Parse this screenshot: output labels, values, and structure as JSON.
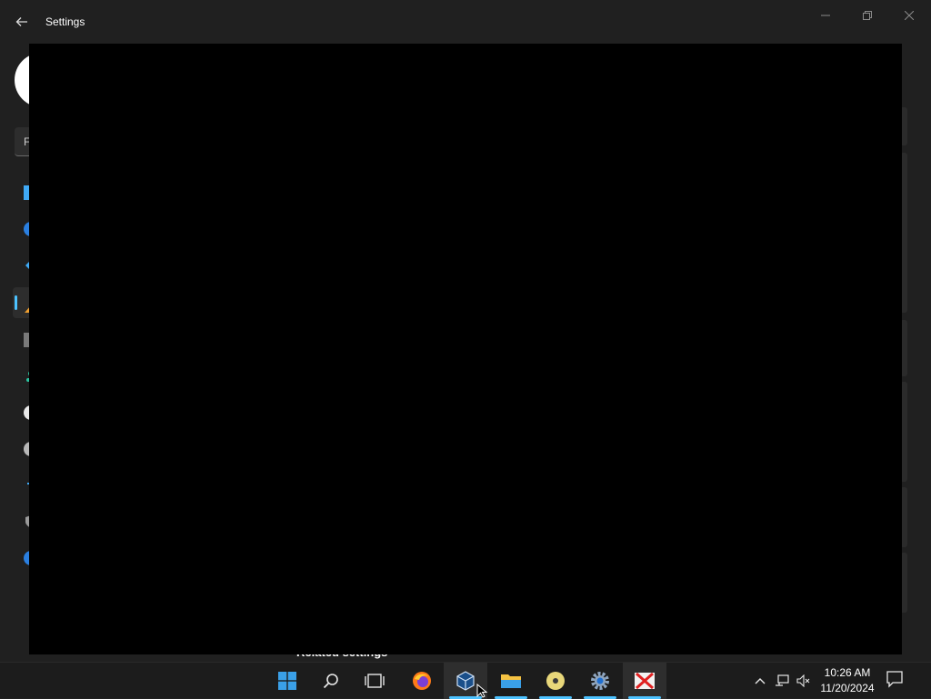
{
  "window": {
    "title": "Settings",
    "back_icon": "arrow-left-icon",
    "minimize_icon": "minimize-icon",
    "maximize_icon": "restore-icon",
    "close_icon": "close-icon"
  },
  "settings_fragments": {
    "search_partial_text": "F",
    "related_settings": "Related settings"
  },
  "taskbar": {
    "apps": [
      {
        "name": "start",
        "icon": "windows-start-icon"
      },
      {
        "name": "search",
        "icon": "search-icon"
      },
      {
        "name": "task-view",
        "icon": "task-view-icon"
      },
      {
        "name": "firefox",
        "icon": "firefox-icon"
      },
      {
        "name": "virtualbox",
        "icon": "virtualbox-icon"
      },
      {
        "name": "file-explorer",
        "icon": "folder-icon"
      },
      {
        "name": "media",
        "icon": "disc-icon"
      },
      {
        "name": "settings",
        "icon": "gear-icon"
      },
      {
        "name": "app-x",
        "icon": "red-x-icon"
      }
    ],
    "tray": {
      "chevron_icon": "chevron-up-icon",
      "network_icon": "network-icon",
      "volume_icon": "volume-muted-icon",
      "notification_icon": "notification-icon"
    },
    "clock": {
      "time": "10:26 AM",
      "date": "11/20/2024"
    }
  },
  "colors": {
    "accent": "#4cc2ff",
    "background": "#202020",
    "overlay": "#000000",
    "taskbar": "#1c1c1c"
  }
}
